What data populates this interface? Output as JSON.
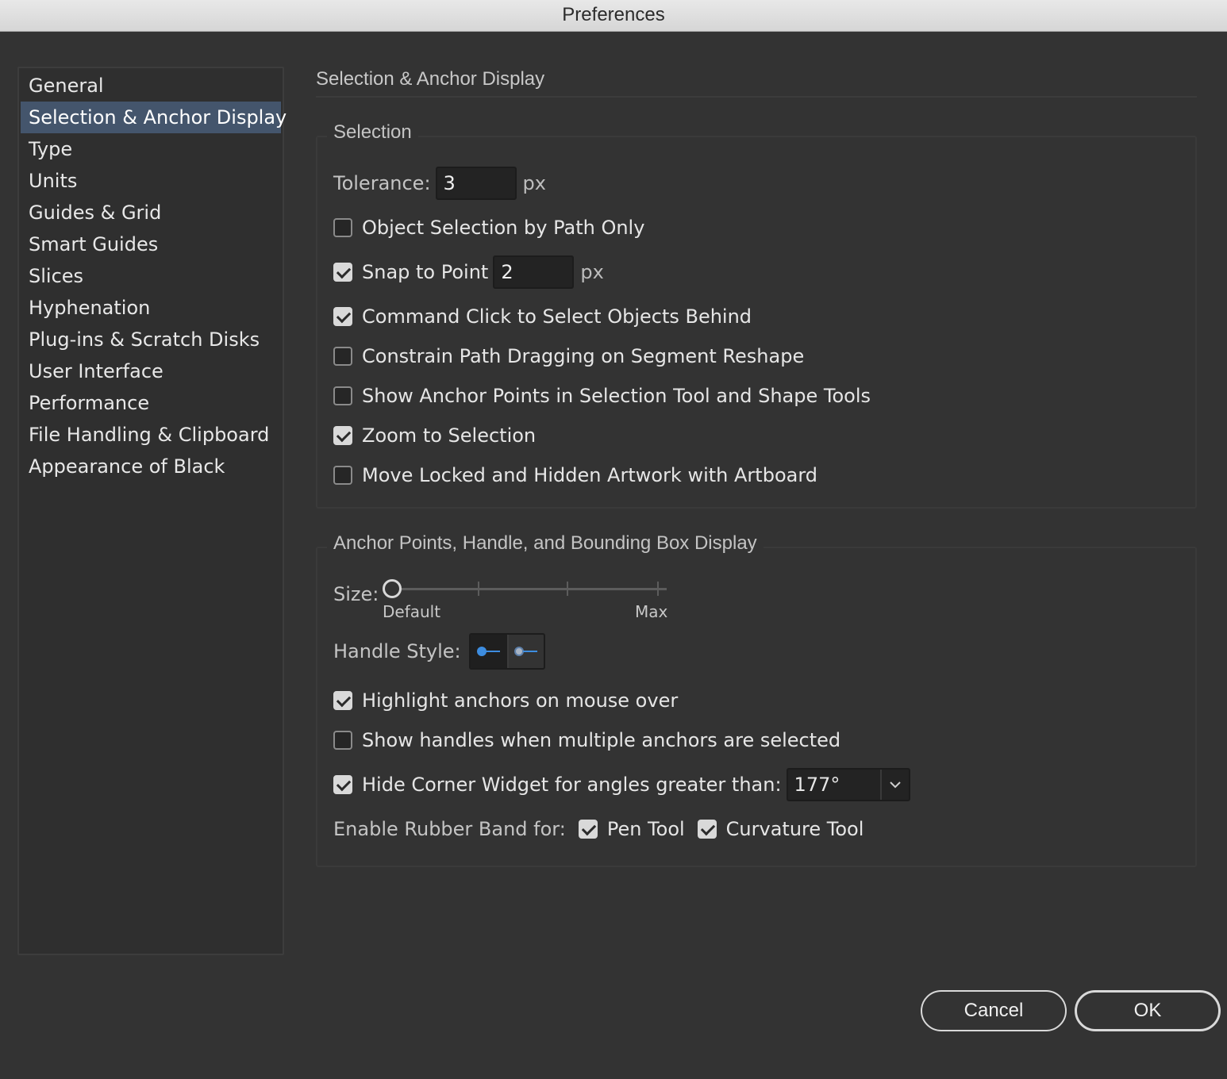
{
  "window": {
    "title": "Preferences"
  },
  "sidebar": {
    "items": [
      {
        "label": "General",
        "active": false
      },
      {
        "label": "Selection & Anchor Display",
        "active": true
      },
      {
        "label": "Type",
        "active": false
      },
      {
        "label": "Units",
        "active": false
      },
      {
        "label": "Guides & Grid",
        "active": false
      },
      {
        "label": "Smart Guides",
        "active": false
      },
      {
        "label": "Slices",
        "active": false
      },
      {
        "label": "Hyphenation",
        "active": false
      },
      {
        "label": "Plug-ins & Scratch Disks",
        "active": false
      },
      {
        "label": "User Interface",
        "active": false
      },
      {
        "label": "Performance",
        "active": false
      },
      {
        "label": "File Handling & Clipboard",
        "active": false
      },
      {
        "label": "Appearance of Black",
        "active": false
      }
    ]
  },
  "main": {
    "title": "Selection & Anchor Display",
    "selection": {
      "label": "Selection",
      "tolerance_label": "Tolerance:",
      "tolerance_value": "3",
      "tolerance_unit": "px",
      "object_selection": {
        "label": "Object Selection by Path Only",
        "checked": false
      },
      "snap_to_point": {
        "label": "Snap to Point",
        "checked": true,
        "value": "2",
        "unit": "px"
      },
      "command_click": {
        "label": "Command Click to Select Objects Behind",
        "checked": true
      },
      "constrain_path": {
        "label": "Constrain Path Dragging on Segment Reshape",
        "checked": false
      },
      "show_anchor_points": {
        "label": "Show Anchor Points in Selection Tool and Shape Tools",
        "checked": false
      },
      "zoom_to_selection": {
        "label": "Zoom to Selection",
        "checked": true
      },
      "move_locked": {
        "label": "Move Locked and Hidden Artwork with Artboard",
        "checked": false
      }
    },
    "anchor_display": {
      "label": "Anchor Points, Handle, and Bounding Box Display",
      "size_label": "Size:",
      "size_min_label": "Default",
      "size_max_label": "Max",
      "size_level": 0,
      "handle_style_label": "Handle Style:",
      "handle_style_selected": 0,
      "highlight_anchors": {
        "label": "Highlight anchors on mouse over",
        "checked": true
      },
      "show_handles": {
        "label": "Show handles when multiple anchors are selected",
        "checked": false
      },
      "hide_corner_widget": {
        "label": "Hide Corner Widget for angles greater than:",
        "checked": true,
        "value": "177°"
      },
      "rubber_band_label": "Enable Rubber Band for:",
      "pen_tool": {
        "label": "Pen Tool",
        "checked": true
      },
      "curvature_tool": {
        "label": "Curvature Tool",
        "checked": true
      }
    }
  },
  "footer": {
    "cancel_label": "Cancel",
    "ok_label": "OK"
  },
  "colors": {
    "background": "#333333",
    "active_item": "#44556c",
    "handle_blue": "#3d8de0"
  }
}
